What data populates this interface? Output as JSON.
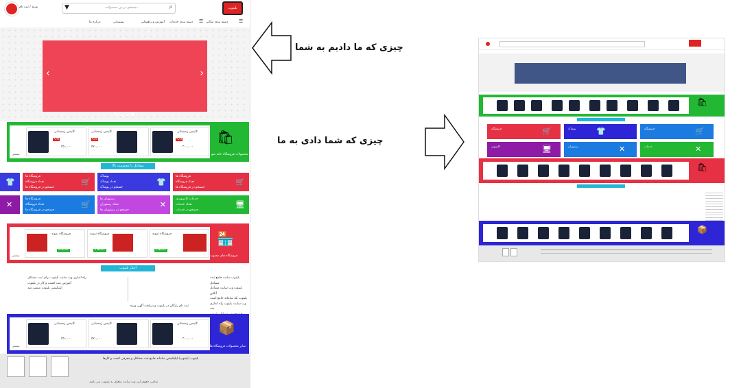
{
  "left_page": {
    "header": {
      "search_placeholder": "جستجو در بین محصولات...",
      "login_label": "ورود / ثبت نام",
      "logo_label": "بلیتوب"
    },
    "nav": [
      "دسته بندی مکانی",
      "دسته بندی خدمات",
      "آموزش و راهنمایی",
      "پشتیبانی",
      "درباره ما"
    ],
    "slider": {
      "prev": "‹",
      "next": "›"
    },
    "sections": {
      "products_title": "محصولات فروشگاه خانه نمو",
      "more_label": "بیشتر",
      "popular_jobs": "مشاغل با محبوبیت بالا",
      "stores_title": "فروشگاه های محبوب",
      "news_title": "اخبار بلیتوب",
      "all_products_title": "سایر محصولات فروشگاه ها"
    },
    "product_cards": [
      {
        "name": "کاپشن زمستانی",
        "price": "۳۰۰,۰۰۰",
        "badge": "ویژه"
      },
      {
        "name": "کاپشن زمستانی",
        "price": "۴۲۰,۰۰۰",
        "badge": "ویژه"
      },
      {
        "name": "کاپشن زمستانی",
        "price": "۳۵۰,۰۰۰",
        "badge": "ویژه"
      }
    ],
    "job_tiles": [
      {
        "title": "فروشگاه ها",
        "line1": "تعداد فروشگاه",
        "line2": "جستجو در فروشگاه ها",
        "icon": "🛒"
      },
      {
        "title": "فروشگاه ها",
        "line1": "تعداد فروشگاه",
        "line2": "جستجو در فروشگاه ها",
        "icon": "🛒"
      },
      {
        "title": "پوشاک",
        "line1": "تعداد پوشاک",
        "line2": "جستجو در پوشاک",
        "icon": "👕"
      },
      {
        "title": "خدمات کامپیوتری",
        "line1": "تعداد خدمات",
        "line2": "جستجو در خدمات",
        "icon": "🖥"
      },
      {
        "title": "رستوران ها",
        "line1": "تعداد رستوران",
        "line2": "جستجو در رستوران ها",
        "icon": "✕"
      },
      {
        "title": "فروشگاه ها",
        "line1": "تعداد فروشگاه",
        "line2": "جستجو در فروشگاه ها",
        "icon": "🛒"
      }
    ],
    "store_cards": [
      {
        "name": "فروشگاه نمونه",
        "badge": "مشاهده"
      },
      {
        "name": "فروشگاه نمونه",
        "badge": "مشاهده"
      },
      {
        "name": "فروشگاه نمونه",
        "badge": "مشاهده"
      }
    ],
    "news_right": [
      "بلیتوب سایت جامع ثبت مشاغل",
      "بلیتوب وب سایت مشاغل آنلاین",
      "بلیتوب یک سامانه جامع است",
      "وب سایت بلیتوب راه اندازی شد",
      "جستجو در مشاغل بلیتوب"
    ],
    "news_left": [
      "راه اندازی وب سایت بلیتوب برای ثبت مشاغل",
      "آموزش ثبت کسب و کار در بلیتوب",
      "اپلیکیشن بلیتوب منتشر شد"
    ],
    "news_bottom": "ثبت نام رایگان در بلیتوب و دریافت آگهی ویژه",
    "footer": {
      "about": "بلیتوب (بلیتوپ) اپلیکیشن سامانه جامع ثبت مشاغل و معرفی کسب و کارها",
      "copyright": "تمامی حقوق این وب سایت متعلق به بلیتوب می باشد"
    }
  },
  "annotations": {
    "top_label": "چیزی که ما دادیم به شما",
    "bottom_label": "چیزی که شما دادی به ما"
  },
  "right_page": {
    "tile_titles": [
      "فروشگاه",
      "پوشاک",
      "فروشگاه",
      "رستوران",
      "کامپیوتر",
      "خدمات"
    ]
  },
  "colors": {
    "green": "#22b833",
    "red": "#e63144",
    "blue": "#2d25d6",
    "accent_cyan": "#22b6d6",
    "slider_red": "#ef4456",
    "slider_navy": "#3f5687",
    "purple": "#8e1aa6",
    "orange_red": "#e63144"
  }
}
